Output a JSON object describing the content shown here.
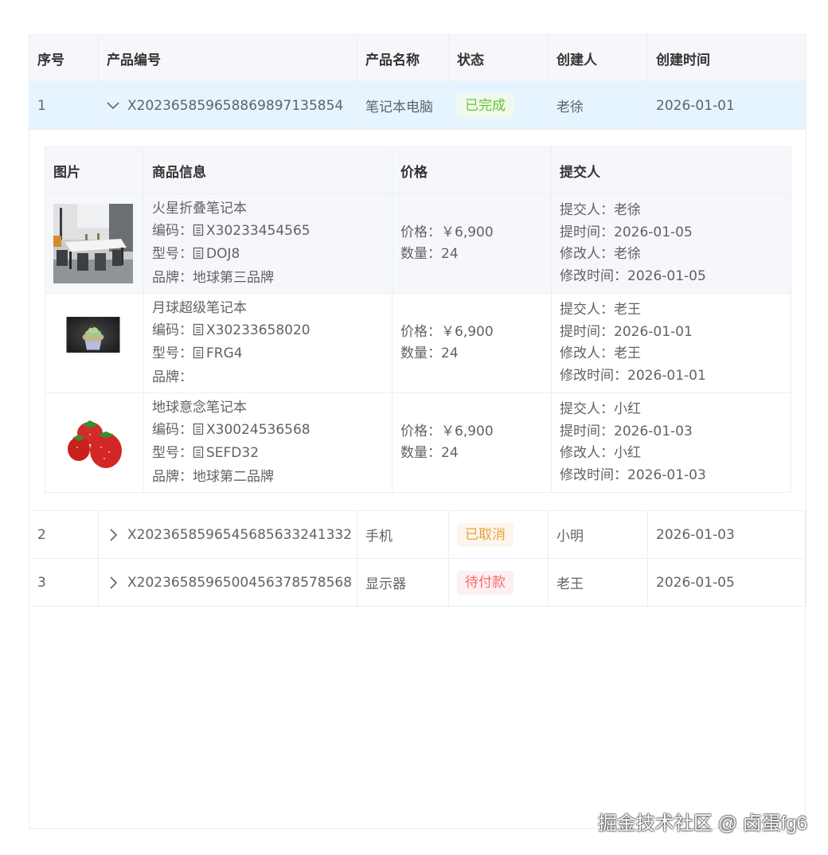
{
  "main_table": {
    "headers": [
      "序号",
      "产品编号",
      "产品名称",
      "状态",
      "创建人",
      "创建时间"
    ],
    "rows": [
      {
        "index": "1",
        "code": "X20236585965886989713585​4",
        "name": "笔记本电脑",
        "status": "已完成",
        "status_type": "success",
        "creator": "老徐",
        "created": "2026-01-01",
        "expanded": true
      },
      {
        "index": "2",
        "code": "X20236585965456856332413​32",
        "name": "手机",
        "status": "已取消",
        "status_type": "warning",
        "creator": "小明",
        "created": "2026-01-03",
        "expanded": false
      },
      {
        "index": "3",
        "code": "X20236585965004563785785​68",
        "name": "显示器",
        "status": "待付款",
        "status_type": "danger",
        "creator": "老王",
        "created": "2026-01-05",
        "expanded": false
      }
    ]
  },
  "sub_table": {
    "headers": [
      "图片",
      "商品信息",
      "价格",
      "提交人"
    ],
    "rows": [
      {
        "image": "dining-table-photo",
        "title": "火星折叠笔记本",
        "code_label": "编码：",
        "code": "X30233454565",
        "model_label": "型号：",
        "model": "DOJ8",
        "brand_label": "品牌：",
        "brand": "地球第三品牌",
        "price_label": "价格：",
        "price": "￥6,900",
        "qty_label": "数量：",
        "qty": "24",
        "submitter_label": "提交人：",
        "submitter": "老徐",
        "submit_time_label": "提时间：",
        "submit_time": "2026-01-05",
        "modifier_label": "修改人：",
        "modifier": "老徐",
        "modify_time_label": "修改时间：",
        "modify_time": "2026-01-05"
      },
      {
        "image": "cupcake-photo",
        "title": "月球超级笔记本",
        "code_label": "编码：",
        "code": "X30233658020",
        "model_label": "型号：",
        "model": "FRG4",
        "brand_label": "品牌：",
        "brand": "",
        "price_label": "价格：",
        "price": "￥6,900",
        "qty_label": "数量：",
        "qty": "24",
        "submitter_label": "提交人：",
        "submitter": "老王",
        "submit_time_label": "提时间：",
        "submit_time": "2026-01-01",
        "modifier_label": "修改人：",
        "modifier": "老王",
        "modify_time_label": "修改时间：",
        "modify_time": "2026-01-01"
      },
      {
        "image": "strawberries-photo",
        "title": "地球意念笔记本",
        "code_label": "编码：",
        "code": "X30024536568",
        "model_label": "型号：",
        "model": "SEFD32",
        "brand_label": "品牌：",
        "brand": "地球第二品牌",
        "price_label": "价格：",
        "price": "￥6,900",
        "qty_label": "数量：",
        "qty": "24",
        "submitter_label": "提交人：",
        "submitter": "小红",
        "submit_time_label": "提时间：",
        "submit_time": "2026-01-03",
        "modifier_label": "修改人：",
        "modifier": "小红",
        "modify_time_label": "修改时间：",
        "modify_time": "2026-01-03"
      }
    ]
  },
  "watermark": "掘金技术社区 @ 卤蛋fg6",
  "colors": {
    "success": "#67c23a",
    "warning": "#e6a23c",
    "danger": "#f56c6c",
    "expanded_row_bg": "#e6f4ff",
    "header_bg": "#f5f7fa"
  }
}
